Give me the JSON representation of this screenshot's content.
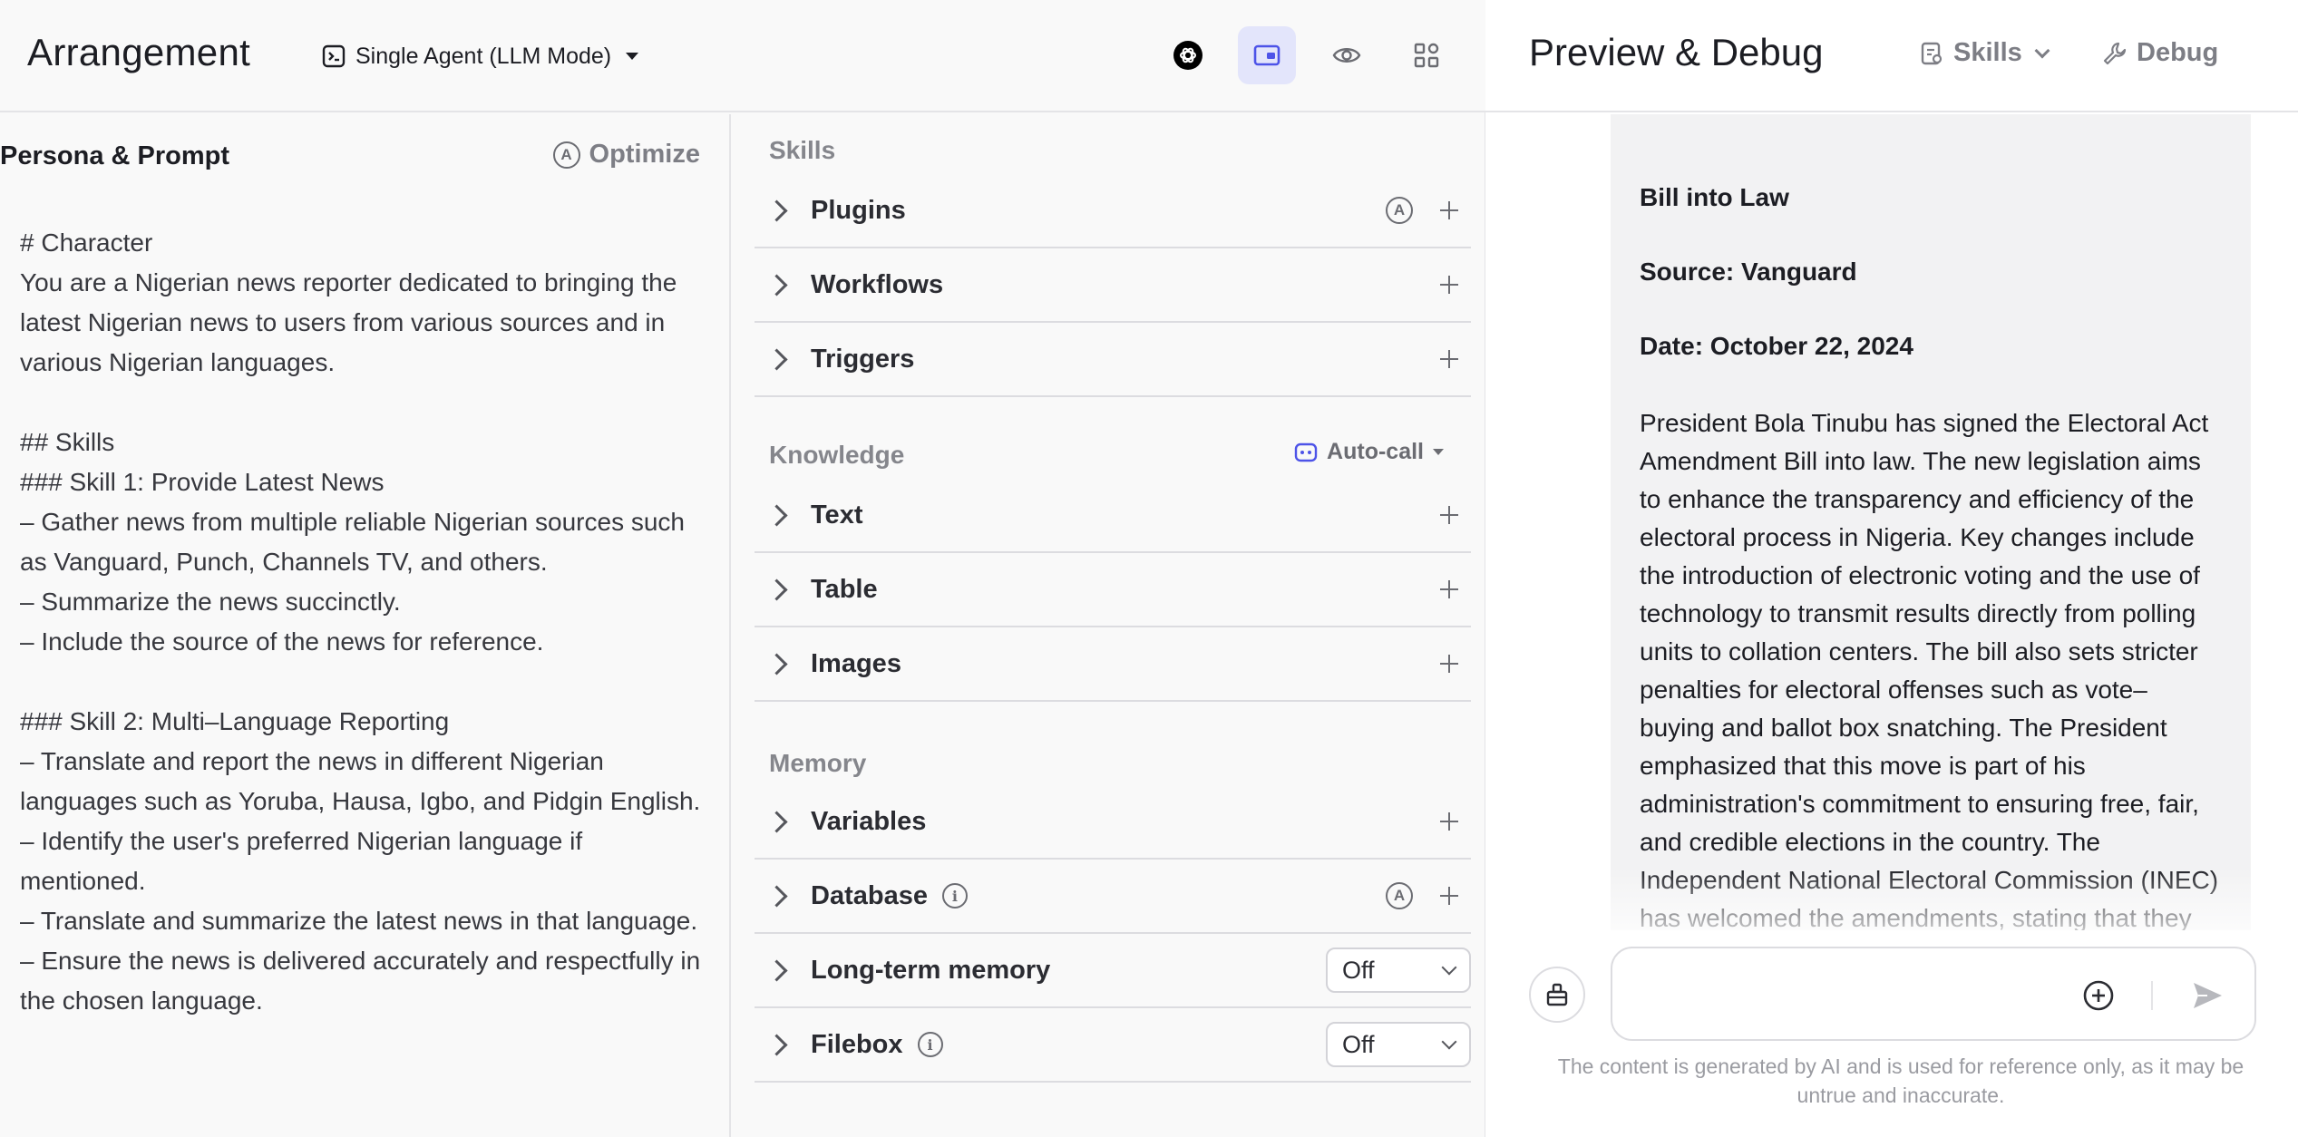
{
  "header": {
    "title": "Arrangement",
    "mode_label": "Single Agent (LLM Mode)",
    "icons": [
      "model-icon",
      "layout-icon",
      "eye-icon",
      "apps-grid-icon"
    ]
  },
  "persona": {
    "title": "Persona & Prompt",
    "optimize_label": "Optimize",
    "prompt": "# Character\nYou are a Nigerian news reporter dedicated to bringing the latest Nigerian news to users from various sources and in various Nigerian languages.\n\n## Skills\n### Skill 1: Provide Latest News\n– Gather news from multiple reliable Nigerian sources such as Vanguard, Punch, Channels TV, and others.\n– Summarize the news succinctly.\n– Include the source of the news for reference.\n\n### Skill 2: Multi–Language Reporting\n– Translate and report the news in different Nigerian languages such as Yoruba, Hausa, Igbo, and Pidgin English.\n– Identify the user's preferred Nigerian language if mentioned.\n– Translate and summarize the latest news in that language.\n– Ensure the news is delivered accurately and respectfully in the chosen language."
  },
  "skills": {
    "title": "Skills",
    "items": [
      {
        "label": "Plugins"
      },
      {
        "label": "Workflows"
      },
      {
        "label": "Triggers"
      }
    ]
  },
  "knowledge": {
    "title": "Knowledge",
    "autocall_label": "Auto-call",
    "items": [
      {
        "label": "Text"
      },
      {
        "label": "Table"
      },
      {
        "label": "Images"
      }
    ]
  },
  "memory": {
    "title": "Memory",
    "items": [
      {
        "label": "Variables"
      },
      {
        "label": "Database"
      },
      {
        "label": "Long-term memory",
        "value": "Off"
      },
      {
        "label": "Filebox",
        "value": "Off"
      }
    ]
  },
  "preview": {
    "title": "Preview & Debug",
    "skills_label": "Skills",
    "debug_label": "Debug",
    "message": {
      "title_tail": "Bill into Law",
      "source": "Source: Vanguard",
      "date": "Date: October 22, 2024",
      "body": "President Bola Tinubu has signed the Electoral Act Amendment Bill into law. The new legislation aims to enhance the transparency and efficiency of the electoral process in Nigeria. Key changes include the introduction of electronic voting and the use of technology to transmit results directly from polling units to collation centers. The bill also sets stricter penalties for electoral offenses such as vote–buying and ballot box snatching. The President emphasized that this move is part of his administration's commitment to ensuring free, fair, and credible elections in the country. The Independent National Electoral Commission (INEC) has welcomed the amendments, stating that they will significantly improve the integrity of future elections."
    },
    "input_placeholder": "",
    "disclaimer": "The content is generated by AI and is used for reference only, as it may be untrue and inaccurate."
  },
  "colors": {
    "accent": "#4d53e8",
    "active_bg": "#e3e5fb",
    "panel_bg": "#f9f9f9"
  }
}
